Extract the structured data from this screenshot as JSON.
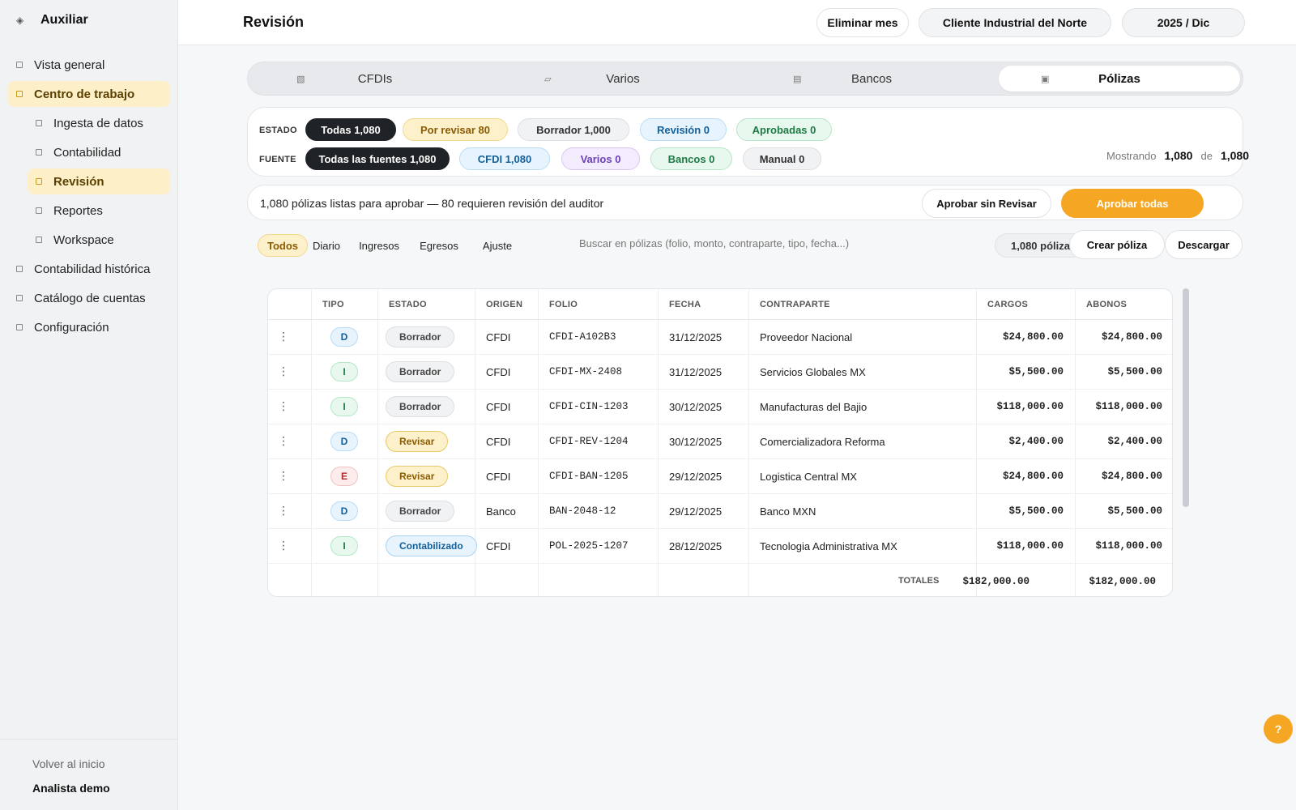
{
  "sidebar": {
    "brand": "Auxiliar",
    "items": [
      {
        "label": "Vista general"
      },
      {
        "label": "Centro de trabajo"
      },
      {
        "label": "Ingesta de datos"
      },
      {
        "label": "Contabilidad"
      },
      {
        "label": "Revisión"
      },
      {
        "label": "Reportes"
      },
      {
        "label": "Workspace"
      },
      {
        "label": "Contabilidad histórica"
      },
      {
        "label": "Catálogo de cuentas"
      },
      {
        "label": "Configuración"
      }
    ],
    "back_label": "Volver al inicio",
    "user_name": "Analista demo"
  },
  "header": {
    "title": "Revisión",
    "delete_month": "Eliminar mes",
    "client": "Cliente Industrial del Norte",
    "period": "2025 / Dic"
  },
  "tabs": [
    {
      "label": "CFDIs",
      "icon": "grid-icon"
    },
    {
      "label": "Varios",
      "icon": "folder-icon"
    },
    {
      "label": "Bancos",
      "icon": "bank-icon"
    },
    {
      "label": "Pólizas",
      "icon": "ledger-icon"
    }
  ],
  "filters": {
    "estado_label": "ESTADO",
    "fuente_label": "FUENTE",
    "estado_chips": [
      "Todas 1,080",
      "Por revisar 80",
      "Borrador 1,000",
      "Revisión 0",
      "Aprobadas 0"
    ],
    "fuente_chips": [
      "Todas las fuentes 1,080",
      "CFDI 1,080",
      "Varios 0",
      "Bancos 0",
      "Manual 0"
    ],
    "showing_label": "Mostrando",
    "showing_count": "1,080",
    "of_label": "de",
    "total_count": "1,080"
  },
  "approval": {
    "message": "1,080 pólizas listas para aprobar — 80 requieren revisión del auditor",
    "approve_without_review": "Aprobar sin Revisar",
    "approve_all": "Aprobar todas"
  },
  "type_filter": {
    "tabs": [
      "Todos",
      "Diario",
      "Ingresos",
      "Egresos",
      "Ajuste"
    ],
    "search_placeholder": "Buscar en pólizas (folio, monto, contraparte, tipo, fecha...)",
    "count_label": "1,080 pólizas",
    "create_label": "Crear póliza",
    "download_label": "Descargar"
  },
  "table": {
    "headers": [
      "TIPO",
      "ESTADO",
      "ORIGEN",
      "FOLIO",
      "FECHA",
      "CONTRAPARTE",
      "CARGOS",
      "ABONOS"
    ],
    "rows": [
      {
        "tipo": "D",
        "estado": "Borrador",
        "origen": "CFDI",
        "folio": "CFDI-A102B3",
        "fecha": "31/12/2025",
        "contraparte": "Proveedor Nacional",
        "cargos": "$24,800.00",
        "abonos": "$24,800.00"
      },
      {
        "tipo": "I",
        "estado": "Borrador",
        "origen": "CFDI",
        "folio": "CFDI-MX-2408",
        "fecha": "31/12/2025",
        "contraparte": "Servicios Globales MX",
        "cargos": "$5,500.00",
        "abonos": "$5,500.00"
      },
      {
        "tipo": "I",
        "estado": "Borrador",
        "origen": "CFDI",
        "folio": "CFDI-CIN-1203",
        "fecha": "30/12/2025",
        "contraparte": "Manufacturas del Bajio",
        "cargos": "$118,000.00",
        "abonos": "$118,000.00"
      },
      {
        "tipo": "D",
        "estado": "Revisar",
        "origen": "CFDI",
        "folio": "CFDI-REV-1204",
        "fecha": "30/12/2025",
        "contraparte": "Comercializadora Reforma",
        "cargos": "$2,400.00",
        "abonos": "$2,400.00"
      },
      {
        "tipo": "E",
        "estado": "Revisar",
        "origen": "CFDI",
        "folio": "CFDI-BAN-1205",
        "fecha": "29/12/2025",
        "contraparte": "Logistica Central MX",
        "cargos": "$24,800.00",
        "abonos": "$24,800.00"
      },
      {
        "tipo": "D",
        "estado": "Borrador",
        "origen": "Banco",
        "folio": "BAN-2048-12",
        "fecha": "29/12/2025",
        "contraparte": "Banco MXN",
        "cargos": "$5,500.00",
        "abonos": "$5,500.00"
      },
      {
        "tipo": "I",
        "estado": "Contabilizado",
        "origen": "CFDI",
        "folio": "POL-2025-1207",
        "fecha": "28/12/2025",
        "contraparte": "Tecnologia Administrativa MX",
        "cargos": "$118,000.00",
        "abonos": "$118,000.00"
      }
    ],
    "totals_label": "TOTALES",
    "totals_cargos": "$182,000.00",
    "totals_abonos": "$182,000.00"
  },
  "help_label": "?"
}
